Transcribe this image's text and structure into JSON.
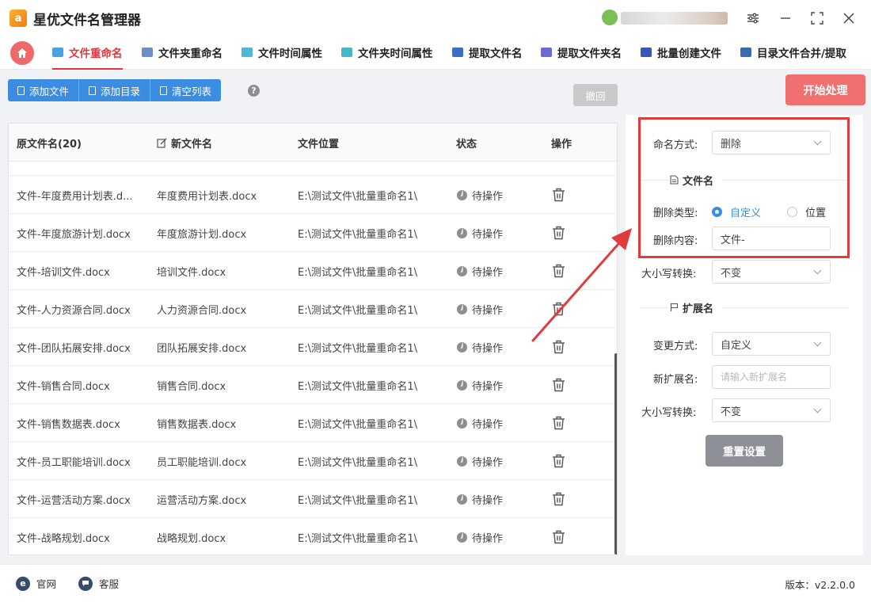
{
  "app": {
    "title": "星优文件名管理器",
    "logo_text": "a"
  },
  "tabs": [
    {
      "label": "文件重命名",
      "active": true,
      "icon_color": "#4aa3df"
    },
    {
      "label": "文件夹重命名",
      "active": false,
      "icon_color": "#6c8fc7"
    },
    {
      "label": "文件时间属性",
      "active": false,
      "icon_color": "#4fb8d6"
    },
    {
      "label": "文件夹时间属性",
      "active": false,
      "icon_color": "#46b6c9"
    },
    {
      "label": "提取文件名",
      "active": false,
      "icon_color": "#3b6fc4"
    },
    {
      "label": "提取文件夹名",
      "active": false,
      "icon_color": "#6d6bd0"
    },
    {
      "label": "批量创建文件",
      "active": false,
      "icon_color": "#3a57b8"
    },
    {
      "label": "目录文件合并/提取",
      "active": false,
      "icon_color": "#3a6db0"
    }
  ],
  "toolbar": {
    "add_file": "添加文件",
    "add_dir": "添加目录",
    "clear_list": "清空列表",
    "help": "?",
    "undo": "撤回",
    "start": "开始处理"
  },
  "table": {
    "headers": {
      "original": "原文件名(20)",
      "new_name": "新文件名",
      "location": "文件位置",
      "status": "状态",
      "action": "操作"
    },
    "rows": [
      {
        "original": "文件-年度费用计划表.d...",
        "new_name": "年度费用计划表.docx",
        "location": "E:\\测试文件\\批量重命名1\\",
        "status": "待操作"
      },
      {
        "original": "文件-年度旅游计划.docx",
        "new_name": "年度旅游计划.docx",
        "location": "E:\\测试文件\\批量重命名1\\",
        "status": "待操作"
      },
      {
        "original": "文件-培训文件.docx",
        "new_name": "培训文件.docx",
        "location": "E:\\测试文件\\批量重命名1\\",
        "status": "待操作"
      },
      {
        "original": "文件-人力资源合同.docx",
        "new_name": "人力资源合同.docx",
        "location": "E:\\测试文件\\批量重命名1\\",
        "status": "待操作"
      },
      {
        "original": "文件-团队拓展安排.docx",
        "new_name": "团队拓展安排.docx",
        "location": "E:\\测试文件\\批量重命名1\\",
        "status": "待操作"
      },
      {
        "original": "文件-销售合同.docx",
        "new_name": "销售合同.docx",
        "location": "E:\\测试文件\\批量重命名1\\",
        "status": "待操作"
      },
      {
        "original": "文件-销售数据表.docx",
        "new_name": "销售数据表.docx",
        "location": "E:\\测试文件\\批量重命名1\\",
        "status": "待操作"
      },
      {
        "original": "文件-员工职能培训.docx",
        "new_name": "员工职能培训.docx",
        "location": "E:\\测试文件\\批量重命名1\\",
        "status": "待操作"
      },
      {
        "original": "文件-运营活动方案.docx",
        "new_name": "运营活动方案.docx",
        "location": "E:\\测试文件\\批量重命名1\\",
        "status": "待操作"
      },
      {
        "original": "文件-战略规划.docx",
        "new_name": "战略规划.docx",
        "location": "E:\\测试文件\\批量重命名1\\",
        "status": "待操作"
      }
    ]
  },
  "panel": {
    "naming_mode_label": "命名方式:",
    "naming_mode_value": "删除",
    "filename_section": "文件名",
    "delete_type_label": "删除类型:",
    "delete_type_custom": "自定义",
    "delete_type_position": "位置",
    "delete_content_label": "删除内容:",
    "delete_content_value": "文件-",
    "case_label": "大小写转换:",
    "case_value": "不变",
    "ext_section": "扩展名",
    "change_mode_label": "变更方式:",
    "change_mode_value": "自定义",
    "new_ext_label": "新扩展名:",
    "new_ext_placeholder": "请输入新扩展名",
    "ext_case_label": "大小写转换:",
    "ext_case_value": "不变",
    "reset": "重置设置"
  },
  "footer": {
    "website": "官网",
    "support": "客服",
    "version": "版本：v2.2.0.0"
  },
  "colors": {
    "accent": "#e0383e",
    "primary": "#3a8de0",
    "start": "#f07070",
    "highlight": "#e23b3b"
  }
}
